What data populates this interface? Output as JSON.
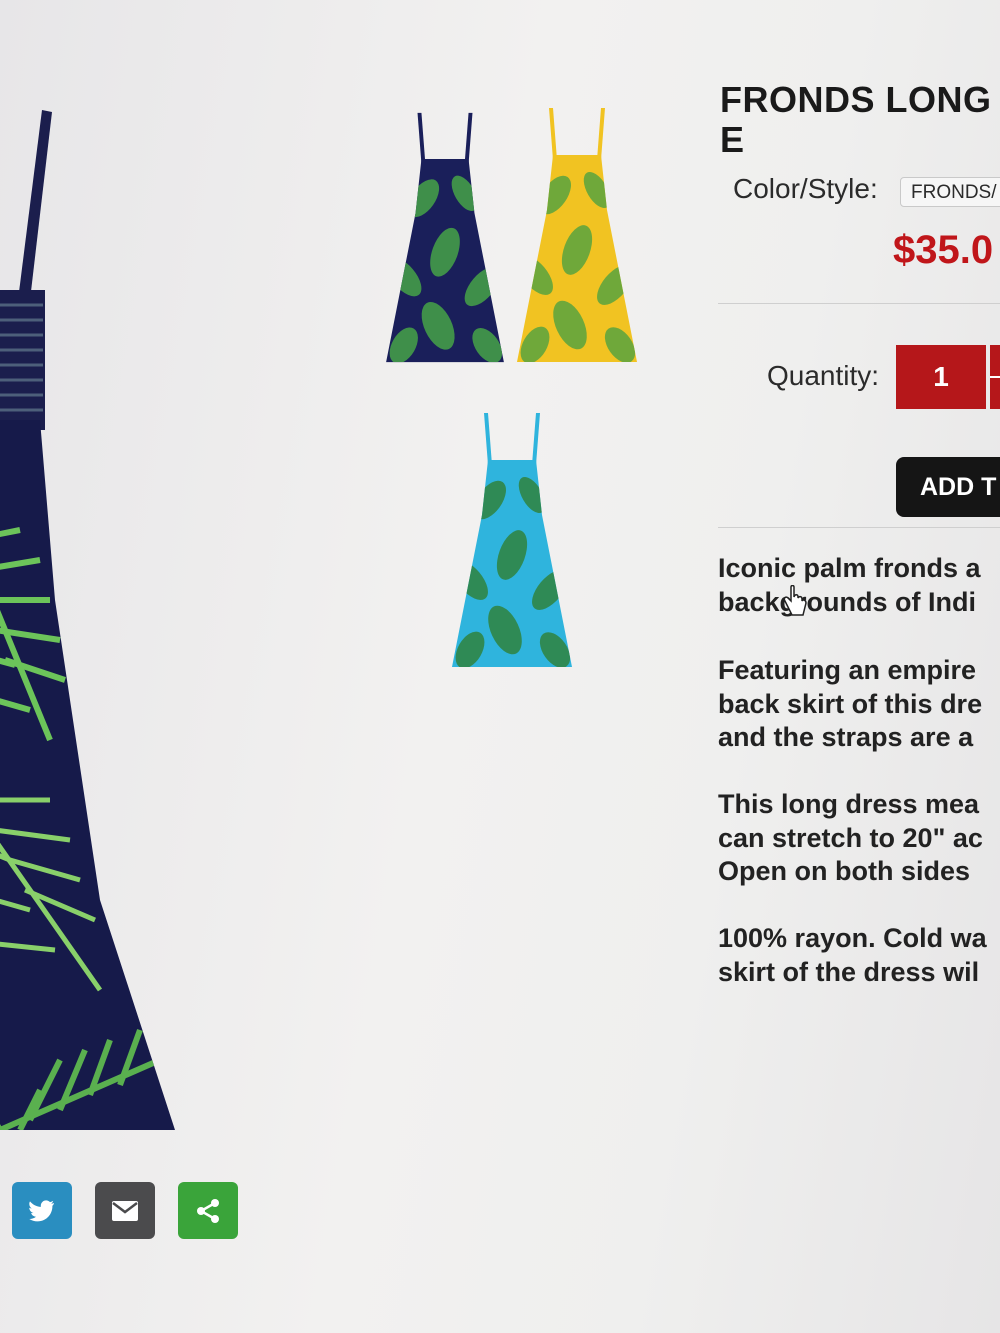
{
  "product": {
    "title_line1": "FRONDS LONG",
    "title_line2": "E",
    "color_style_label": "Color/Style:",
    "color_style_value": "FRONDS/",
    "price": "$35.0",
    "quantity_label": "Quantity:",
    "quantity_value": "1",
    "add_button_label": "ADD T"
  },
  "description": {
    "p1": [
      "Iconic palm fronds a",
      "backgrounds of Indi"
    ],
    "p2": [
      "Featuring an empire",
      "back skirt of this dre",
      "and the straps are a"
    ],
    "p3": [
      "This long dress mea",
      "can stretch to 20\" ac",
      "Open on both sides"
    ],
    "p4": [
      "100% rayon. Cold wa",
      "skirt of the dress wil"
    ]
  },
  "thumbnails": [
    {
      "name": "navy",
      "body_color": "#1a1f5a",
      "leaf_color": "#3f8f4a"
    },
    {
      "name": "yellow",
      "body_color": "#f1c322",
      "leaf_color": "#6fa83a"
    },
    {
      "name": "turquoise",
      "body_color": "#2fb4dd",
      "leaf_color": "#2f8a55"
    }
  ],
  "share_icons": [
    "twitter-icon",
    "email-icon",
    "share-icon"
  ],
  "colors": {
    "accent_red": "#b5171a",
    "price_red": "#c0161a",
    "button_black": "#151515",
    "twitter_blue": "#2a8ec0",
    "email_gray": "#4b4b4d",
    "share_green": "#3aa43a"
  }
}
